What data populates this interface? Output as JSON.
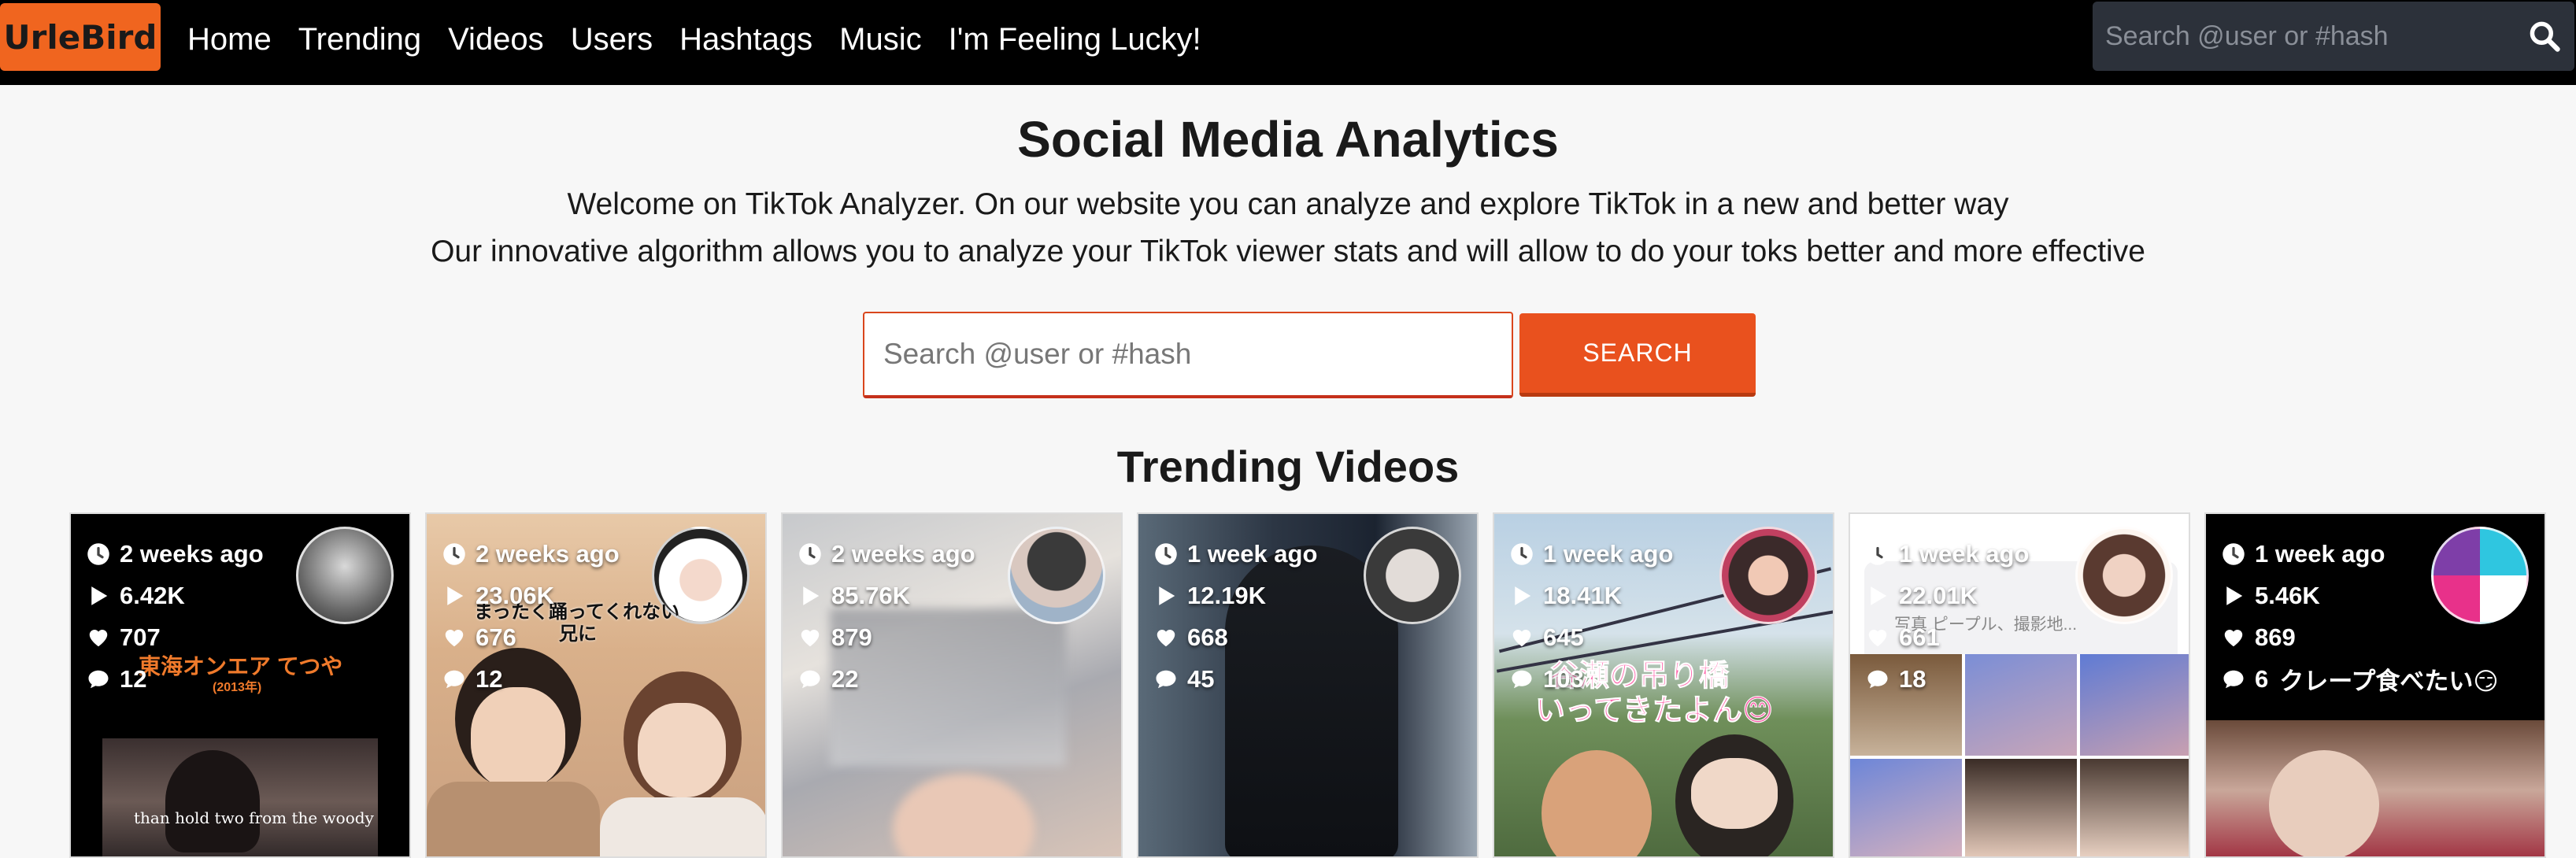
{
  "nav": {
    "logo": "UrleBird",
    "links": [
      "Home",
      "Trending",
      "Videos",
      "Users",
      "Hashtags",
      "Music",
      "I'm Feeling Lucky!"
    ],
    "search_placeholder": "Search @user or #hash"
  },
  "hero": {
    "title": "Social Media Analytics",
    "line1": "Welcome on TikTok Analyzer. On our website you can analyze and explore TikTok in a new and better way",
    "line2": "Our innovative algorithm allows you to analyze your TikTok viewer stats and will allow to do your toks better and more effective",
    "search_placeholder": "Search @user or #hash",
    "search_button": "SEARCH"
  },
  "trending_title": "Trending Videos",
  "videos": [
    {
      "time": "2 weeks ago",
      "views": "6.42K",
      "likes": "707",
      "comments": "12",
      "overlay": "東海オンエア てつや",
      "overlay2": "(2013年)",
      "caption": "than hold two from the woody"
    },
    {
      "time": "2 weeks ago",
      "views": "23.06K",
      "likes": "676",
      "comments": "12",
      "overlay": "まったく踊ってくれない",
      "overlay2": "兄に"
    },
    {
      "time": "2 weeks ago",
      "views": "85.76K",
      "likes": "879",
      "comments": "22"
    },
    {
      "time": "1 week ago",
      "views": "12.19K",
      "likes": "668",
      "comments": "45"
    },
    {
      "time": "1 week ago",
      "views": "18.41K",
      "likes": "645",
      "comments": "103",
      "overlay": "谷瀬の吊り橋",
      "overlay2": "いってきたよん😊"
    },
    {
      "time": "1 week ago",
      "views": "22.01K",
      "likes": "661",
      "comments": "18",
      "overlay": "写真 ピープル、撮影地..."
    },
    {
      "time": "1 week ago",
      "views": "5.46K",
      "likes": "869",
      "comments": "6",
      "overlay": "クレープ食べたい😏"
    }
  ],
  "colors": {
    "brand": "#f0651f",
    "nav_bg": "#000000",
    "button": "#e9511e"
  }
}
